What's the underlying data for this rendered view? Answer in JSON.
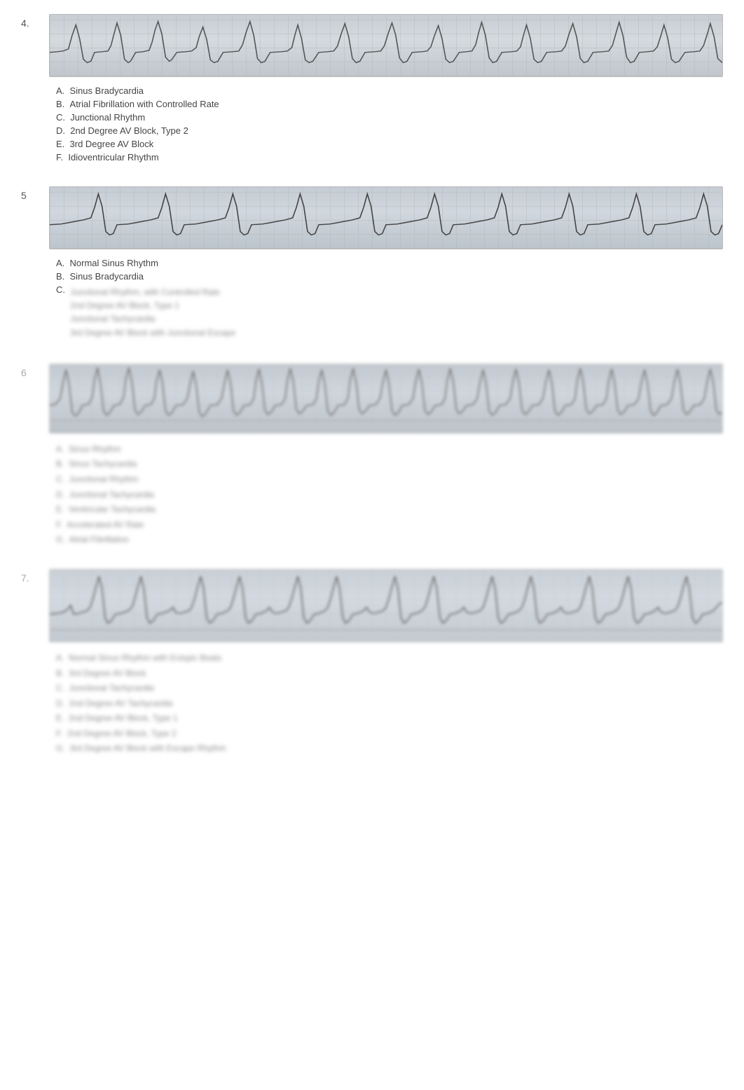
{
  "questions": [
    {
      "number": "4.",
      "options": [
        {
          "letter": "A.",
          "text": "Sinus Bradycardia"
        },
        {
          "letter": "B.",
          "text": "Atrial Fibrillation with Controlled Rate"
        },
        {
          "letter": "C.",
          "text": "Junctional Rhythm"
        },
        {
          "letter": "D.",
          "text": "2nd Degree AV Block, Type 2"
        },
        {
          "letter": "E.",
          "text": "3rd Degree AV Block"
        },
        {
          "letter": "F.",
          "text": "Idioventricular Rhythm"
        }
      ],
      "blurred": false
    },
    {
      "number": "5",
      "options": [
        {
          "letter": "A.",
          "text": "Normal Sinus Rhythm"
        },
        {
          "letter": "B.",
          "text": "Sinus Bradycardia"
        },
        {
          "letter": "C.",
          "text": ""
        }
      ],
      "blurred": false,
      "sub_options_blurred": true,
      "sub_options": [
        "Junctional Rhythm, with Controlled Rate",
        "2nd Degree AV Block, Type 1",
        "Junctional Tachycardia",
        "3rd Degree AV Block with Junctional Escape"
      ]
    },
    {
      "number": "6",
      "options": [],
      "blurred": true,
      "blurred_options": [
        "Sinus Rhythm",
        "Sinus Tachycardia",
        "Junctional Rhythm",
        "Junctional Tachycardia",
        "Ventricular Tachycardia",
        "Accelerated AV Rate",
        "Atrial Fibrillation"
      ]
    },
    {
      "number": "7",
      "options": [],
      "blurred": true,
      "blurred_options": [
        "Normal Sinus Rhythm with Ectopic Beats",
        "3rd Degree AV Block",
        "Junctional Tachycardia",
        "2nd Degree AV Tachycardia",
        "2nd Degree AV Block, Type 1",
        "2nd Degree AV Block, Type 2",
        "3rd Degree AV Block with Escape Rhythm"
      ]
    }
  ]
}
